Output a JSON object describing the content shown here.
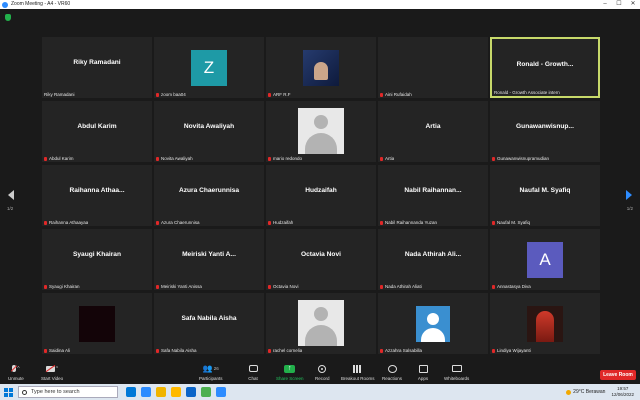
{
  "window": {
    "title": "Zoom Meeting - A4 - VR60",
    "controls": [
      "–",
      "☐",
      "✕"
    ]
  },
  "meeting": {
    "view_label": "",
    "pager": {
      "left_label": "1/2",
      "right_label": "1/2"
    },
    "tiles": [
      {
        "display": "text",
        "big": "Riky Ramadani",
        "small": "Riky Ramadani",
        "muted": false,
        "active": false
      },
      {
        "display": "letter",
        "letter": "Z",
        "color": "#1e9aa6",
        "small": "zoom baa04",
        "muted": true,
        "active": false
      },
      {
        "display": "photo1",
        "small": "ARF R.F",
        "muted": true,
        "active": false
      },
      {
        "display": "empty",
        "small": "Aini Rufaidah",
        "muted": true,
        "active": false
      },
      {
        "display": "text",
        "big": "Ronald - Growth...",
        "small": "Ronald - Growth Associate intern",
        "muted": false,
        "active": true
      },
      {
        "display": "text",
        "big": "Abdul Karim",
        "small": "Abdul Karim",
        "muted": true,
        "active": false
      },
      {
        "display": "text",
        "big": "Novita Awaliyah",
        "small": "Novita Awaliyah",
        "muted": true,
        "active": false
      },
      {
        "display": "anon",
        "small": "mario redondo",
        "muted": true,
        "active": false
      },
      {
        "display": "text",
        "big": "Artia",
        "small": "Artia",
        "muted": true,
        "active": false
      },
      {
        "display": "text",
        "big": "Gunawanwisnup...",
        "small": "Gunawanwisnupramudian",
        "muted": true,
        "active": false
      },
      {
        "display": "text",
        "big": "Raihanna Athaa...",
        "small": "Raihanna Athaayaa",
        "muted": true,
        "active": false
      },
      {
        "display": "text",
        "big": "Azura Chaerunnisa",
        "small": "Azura Chaerunnisa",
        "muted": true,
        "active": false
      },
      {
        "display": "text",
        "big": "Hudzaifah",
        "small": "Hudzaifah",
        "muted": true,
        "active": false
      },
      {
        "display": "text",
        "big": "Nabil Raihannan...",
        "small": "Nabil Raihannanda Yuzan",
        "muted": true,
        "active": false
      },
      {
        "display": "text",
        "big": "Naufal M. Syafiq",
        "small": "Naufal M. Syafiq",
        "muted": true,
        "active": false
      },
      {
        "display": "text",
        "big": "Syaugi Khairan",
        "small": "Syaugi Khairan",
        "muted": true,
        "active": false
      },
      {
        "display": "text",
        "big": "Meiriski Yanti A...",
        "small": "Meiriski Yanti Anissa",
        "muted": true,
        "active": false
      },
      {
        "display": "text",
        "big": "Octavia Novi",
        "small": "Octavia Novi",
        "muted": true,
        "active": false
      },
      {
        "display": "text",
        "big": "Nada Athirah Ali...",
        "small": "Nada Athirah Aliati",
        "muted": true,
        "active": false
      },
      {
        "display": "letter",
        "letter": "A",
        "color": "#5b5bbe",
        "small": "Annastasya Diva",
        "muted": true,
        "active": false
      },
      {
        "display": "dark",
        "small": "Saidina Ali",
        "muted": true,
        "active": false
      },
      {
        "display": "text",
        "big": "Safa Nabila Aisha",
        "small": "Safa Nabila Aisha",
        "muted": true,
        "active": false
      },
      {
        "display": "anon",
        "small": "rachel cornelia",
        "muted": true,
        "active": false
      },
      {
        "display": "blue",
        "small": "Azzahra Salsabilla",
        "muted": true,
        "active": false
      },
      {
        "display": "photo2",
        "small": "Lindiya Wijayanti",
        "muted": true,
        "active": false
      }
    ]
  },
  "toolbar": {
    "unmute": "Unmute",
    "start_video": "Start Video",
    "participants": "Participants",
    "participants_count": "26",
    "chat": "Chat",
    "share_screen": "Share Screen",
    "record": "Record",
    "breakout_rooms": "Breakout Rooms",
    "reactions": "Reactions",
    "apps": "Apps",
    "whiteboards": "Whiteboards",
    "leave": "Leave Room"
  },
  "taskbar": {
    "search_placeholder": "Type here to search",
    "weather": "29°C  Berawan",
    "time": "19:57",
    "date": "12/06/2022",
    "app_icons": [
      "#0078d7",
      "#2d8cff",
      "#f0b400",
      "#ffb900",
      "#0a64c8",
      "#4caf50",
      "#2d8cff"
    ]
  },
  "colors": {
    "active_border": "#c7d96a",
    "leave": "#e02828",
    "share": "#22b04b"
  }
}
